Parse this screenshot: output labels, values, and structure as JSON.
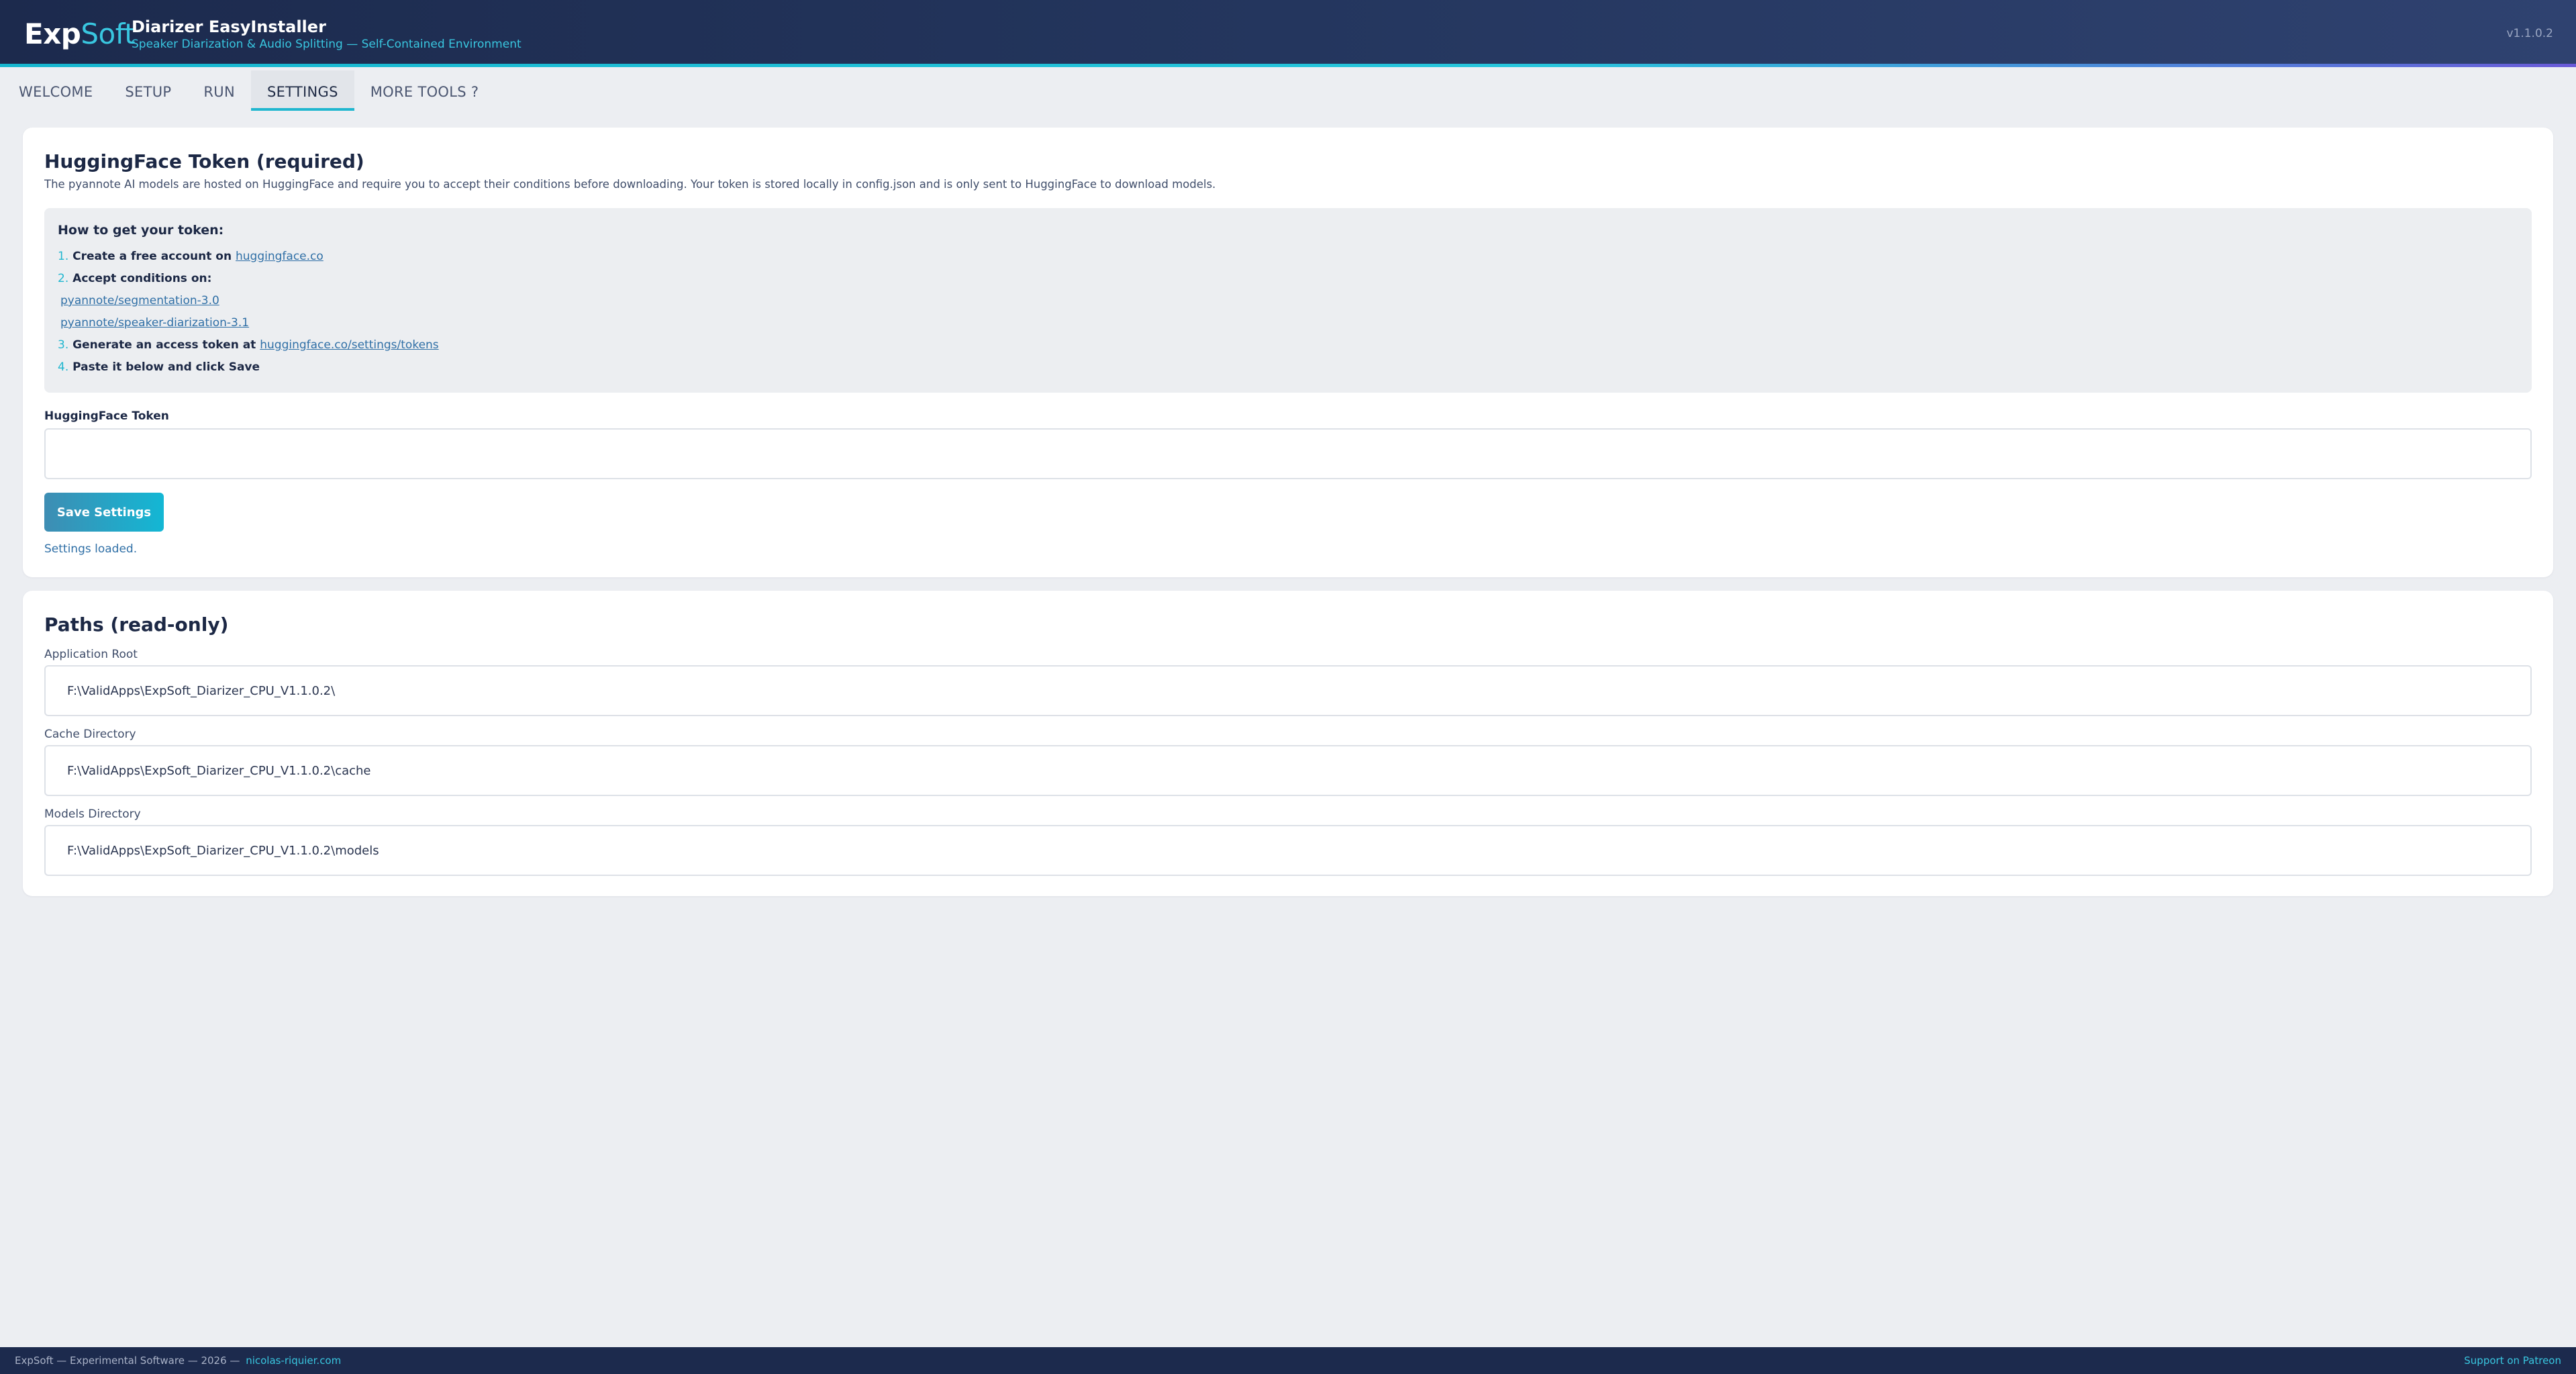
{
  "header": {
    "logo_main": "Exp",
    "logo_accent": "Soft",
    "title": "Diarizer EasyInstaller",
    "subtitle": "Speaker Diarization & Audio Splitting — Self-Contained Environment",
    "version": "v1.1.0.2"
  },
  "tabs": [
    {
      "label": "WELCOME",
      "active": false
    },
    {
      "label": "SETUP",
      "active": false
    },
    {
      "label": "RUN",
      "active": false
    },
    {
      "label": "SETTINGS",
      "active": true
    },
    {
      "label": "MORE TOOLS ?",
      "active": false
    }
  ],
  "token_card": {
    "title": "HuggingFace Token (required)",
    "description": "The pyannote AI models are hosted on HuggingFace and require you to accept their conditions before downloading. Your token is stored locally in config.json and is only sent to HuggingFace to download models.",
    "howto_title": "How to get your token:",
    "step1_num": "1.",
    "step1_text": "Create a free account on ",
    "step1_link": "huggingface.co",
    "step2_num": "2.",
    "step2_text": "Accept conditions on:",
    "step2_link_a": "pyannote/segmentation-3.0",
    "step2_link_b": "pyannote/speaker-diarization-3.1",
    "step3_num": "3.",
    "step3_text": "Generate an access token at ",
    "step3_link": "huggingface.co/settings/tokens",
    "step4_num": "4.",
    "step4_text": "Paste it below and click Save",
    "token_label": "HuggingFace Token",
    "token_value": "",
    "save_label": "Save Settings",
    "status": "Settings loaded."
  },
  "paths_card": {
    "title": "Paths (read-only)",
    "app_root_label": "Application Root",
    "app_root_value": "F:\\ValidApps\\ExpSoft_Diarizer_CPU_V1.1.0.2\\",
    "cache_label": "Cache Directory",
    "cache_value": "F:\\ValidApps\\ExpSoft_Diarizer_CPU_V1.1.0.2\\cache",
    "models_label": "Models Directory",
    "models_value": "F:\\ValidApps\\ExpSoft_Diarizer_CPU_V1.1.0.2\\models"
  },
  "footer": {
    "left_text": "ExpSoft — Experimental Software — 2026 — ",
    "left_link": "nicolas-riquier.com",
    "right_link": "Support on Patreon"
  },
  "colors": {
    "accent": "#1fb6cf",
    "header_bg": "#1c2a4d",
    "page_bg": "#eceef2",
    "link": "#2f6fa6"
  }
}
